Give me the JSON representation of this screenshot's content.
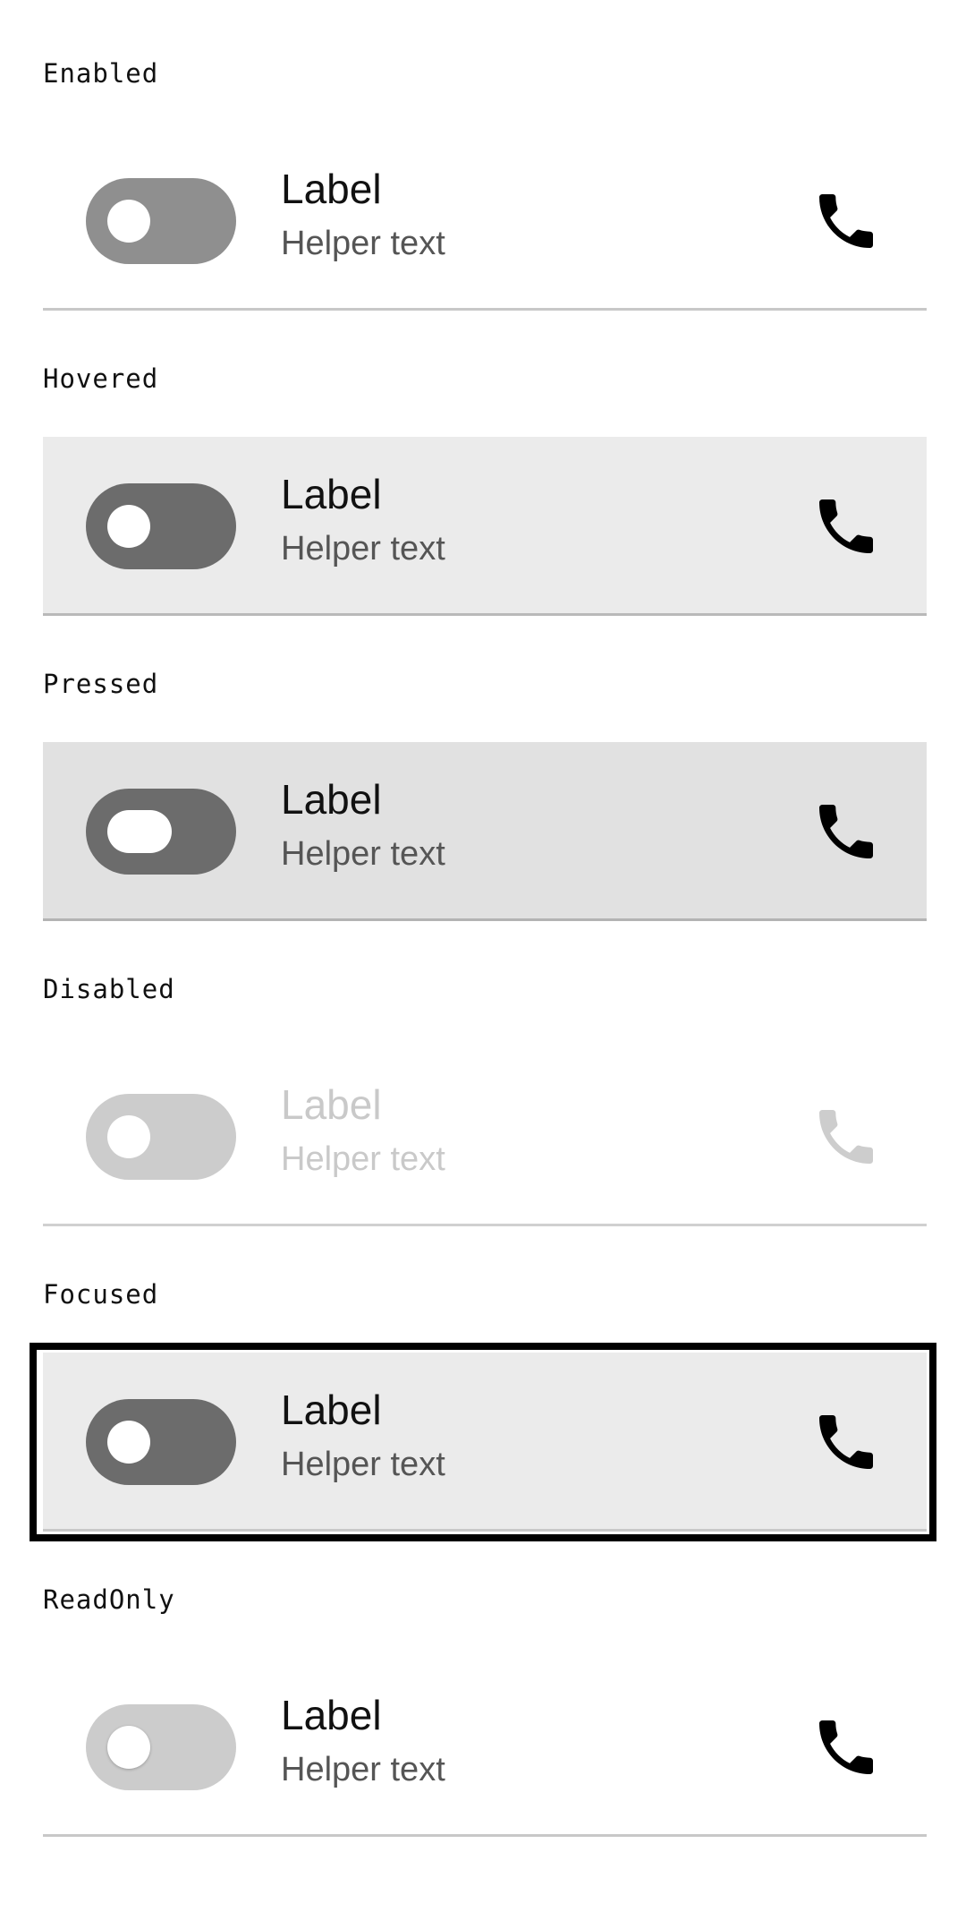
{
  "states": [
    {
      "caption": "Enabled",
      "label": "Label",
      "helper": "Helper text"
    },
    {
      "caption": "Hovered",
      "label": "Label",
      "helper": "Helper text"
    },
    {
      "caption": "Pressed",
      "label": "Label",
      "helper": "Helper text"
    },
    {
      "caption": "Disabled",
      "label": "Label",
      "helper": "Helper text"
    },
    {
      "caption": "Focused",
      "label": "Label",
      "helper": "Helper text"
    },
    {
      "caption": "ReadOnly",
      "label": "Label",
      "helper": "Helper text"
    }
  ],
  "icons": {
    "trailing": "phone-icon"
  },
  "colors": {
    "focus_ring": "#000000",
    "hover_background": "#ebebeb",
    "pressed_background": "#e1e1e1",
    "track_enabled": "#8f8f8f",
    "track_active": "#6c6c6c",
    "track_disabled": "#cccccc",
    "disabled_text": "#c9c9c9"
  }
}
